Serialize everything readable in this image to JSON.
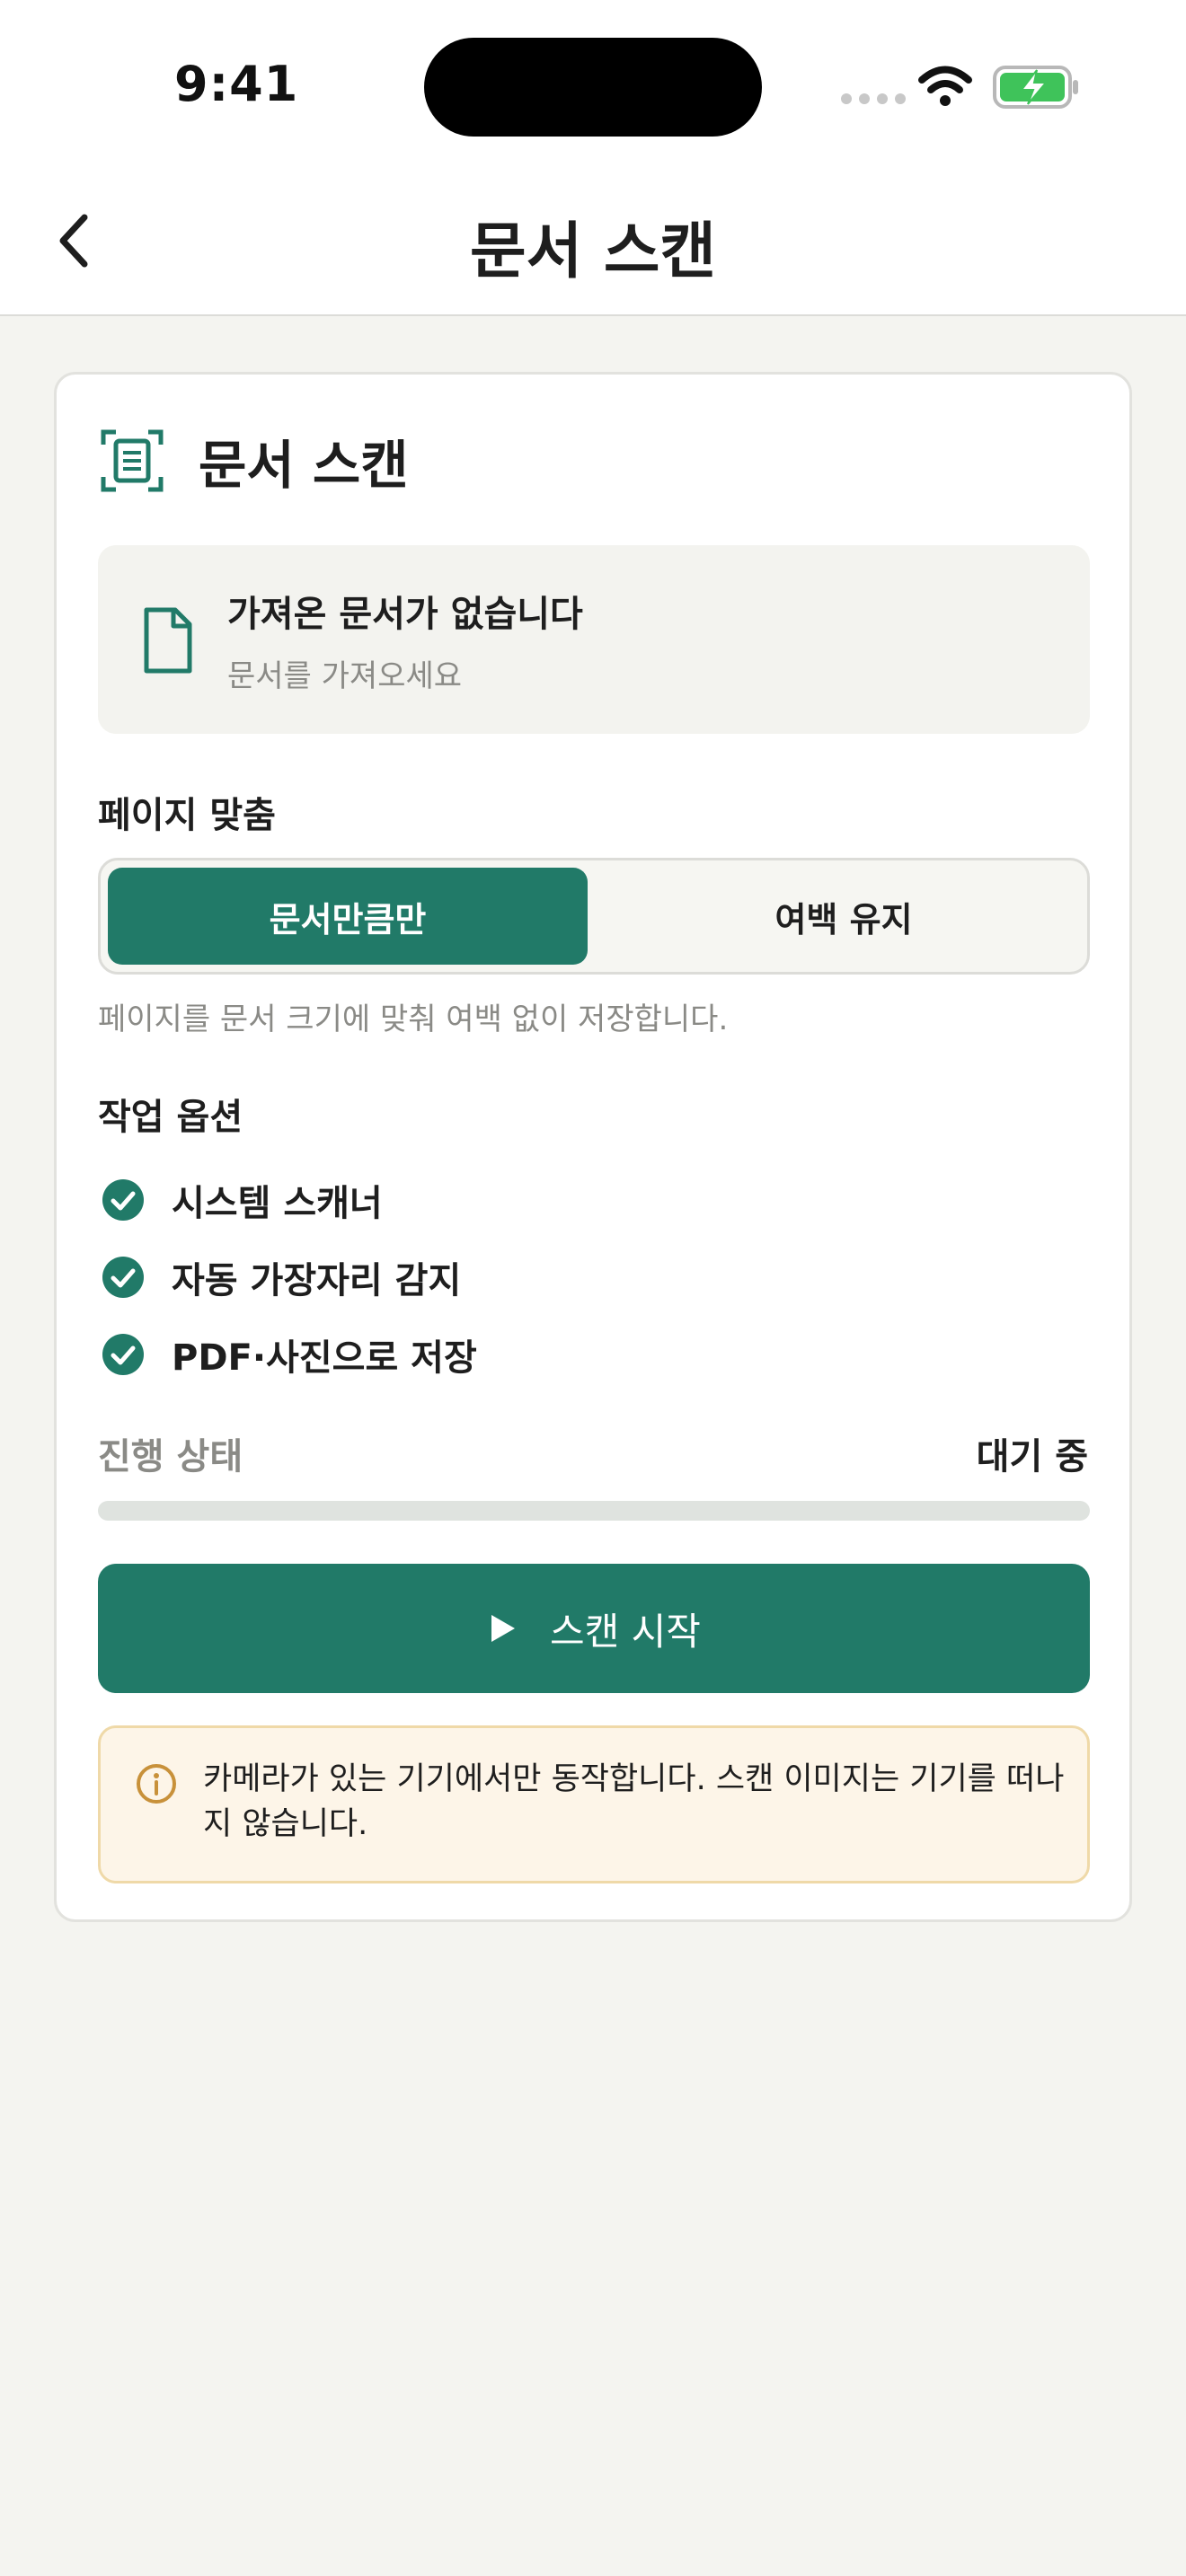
{
  "status_bar": {
    "time": "9:41"
  },
  "nav": {
    "title": "문서 스캔"
  },
  "card": {
    "title": "문서 스캔",
    "document": {
      "title": "가져온 문서가 없습니다",
      "subtitle": "문서를 가져오세요"
    },
    "page_fit": {
      "label": "페이지 맞춤",
      "options": [
        "문서만큼만",
        "여백 유지"
      ],
      "selected": "문서만큼만",
      "hint": "페이지를 문서 크기에 맞춰 여백 없이 저장합니다."
    },
    "options_section": {
      "label": "작업 옵션",
      "items": [
        "시스템 스캐너",
        "자동 가장자리 감지",
        "PDF·사진으로 저장"
      ]
    },
    "progress": {
      "label": "진행 상태",
      "state": "대기 중",
      "value": 0
    },
    "scan_button": {
      "label": "스캔 시작",
      "icon": "play-icon"
    },
    "notice": {
      "icon": "info-icon",
      "text": "카메라가 있는 기기에서만 동작합니다. 스캔 이미지는 기기를 떠나지 않습니다."
    }
  },
  "colors": {
    "accent": "#217a68",
    "background": "#f4f4f0",
    "notice_bg": "#fdf5e8",
    "notice_border": "#efd9a8",
    "info_icon": "#c8913a"
  }
}
